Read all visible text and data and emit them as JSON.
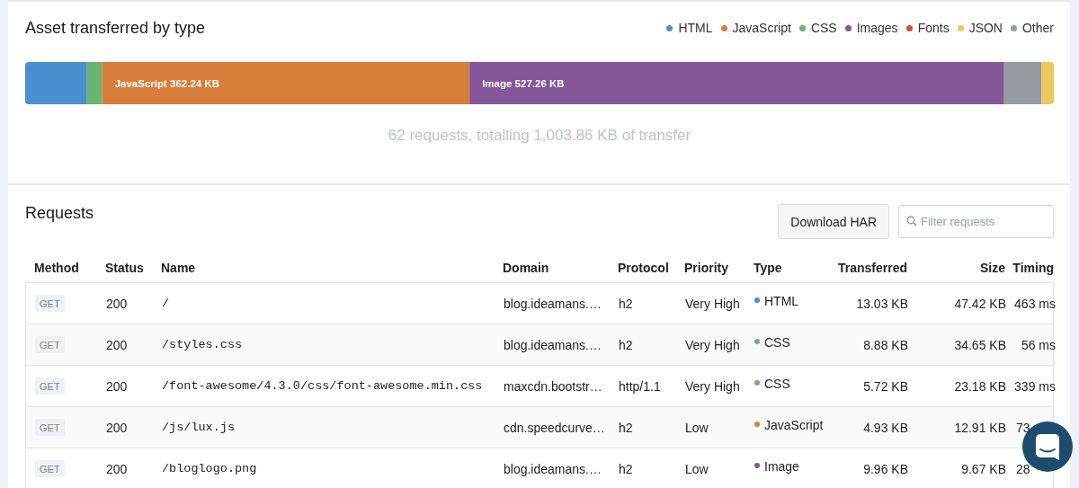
{
  "asset_panel": {
    "title": "Asset transferred by type",
    "legend": [
      {
        "label": "HTML",
        "color": "#4a90d0"
      },
      {
        "label": "JavaScript",
        "color": "#d77e3a"
      },
      {
        "label": "CSS",
        "color": "#67b56f"
      },
      {
        "label": "Images",
        "color": "#84569a"
      },
      {
        "label": "Fonts",
        "color": "#d64a3b"
      },
      {
        "label": "JSON",
        "color": "#ecc95a"
      },
      {
        "label": "Other",
        "color": "#959ba1"
      }
    ],
    "chart_data": {
      "type": "bar",
      "orientation": "horizontal",
      "stacked": true,
      "series": [
        {
          "color": "#4a90d0",
          "values": [
            61
          ]
        },
        {
          "color": "#67b56f",
          "values": [
            15
          ]
        },
        {
          "color": "#d77e3a",
          "values": [
            362.24
          ],
          "value_labels": [
            "JavaScript 362.24 KB"
          ]
        },
        {
          "color": "#84569a",
          "values": [
            527.26
          ],
          "value_labels": [
            "Image 527.26 KB"
          ]
        },
        {
          "color": "#959ba1",
          "values": [
            37
          ]
        },
        {
          "color": "#ecc95a",
          "values": [
            12
          ]
        }
      ]
    },
    "summary": "62 requests, totalling 1,003.86 KB of transfer"
  },
  "requests_panel": {
    "title": "Requests",
    "download_button": "Download HAR",
    "filter": {
      "placeholder": "Filter requests"
    },
    "columns": [
      "Method",
      "Status",
      "Name",
      "Domain",
      "Protocol",
      "Priority",
      "Type",
      "Transferred",
      "Size",
      "Timing"
    ],
    "rows": [
      {
        "method": "GET",
        "status": "200",
        "name": "/",
        "domain": "blog.ideamans.…",
        "protocol": "h2",
        "priority": "Very High",
        "type": {
          "label": "HTML",
          "color": "#4a90d0"
        },
        "transferred": "13.03 KB",
        "size": "47.42 KB",
        "timing": "463 ms"
      },
      {
        "method": "GET",
        "status": "200",
        "name": "/styles.css",
        "domain": "blog.ideamans.…",
        "protocol": "h2",
        "priority": "Very High",
        "type": {
          "label": "CSS",
          "color": "#67b56f"
        },
        "transferred": "8.88 KB",
        "size": "34.65 KB",
        "timing": "56 ms"
      },
      {
        "method": "GET",
        "status": "200",
        "name": "/font-awesome/4.3.0/css/font-awesome.min.css",
        "domain": "maxcdn.bootstr…",
        "protocol": "http/1.1",
        "priority": "Very High",
        "type": {
          "label": "CSS",
          "color": "#67b56f"
        },
        "transferred": "5.72 KB",
        "size": "23.18 KB",
        "timing": "339 ms"
      },
      {
        "method": "GET",
        "status": "200",
        "name": "/js/lux.js",
        "domain": "cdn.speedcurve…",
        "protocol": "h2",
        "priority": "Low",
        "type": {
          "label": "JavaScript",
          "color": "#d77e3a"
        },
        "transferred": "4.93 KB",
        "size": "12.91 KB",
        "timing": "73"
      },
      {
        "method": "GET",
        "status": "200",
        "name": "/bloglogo.png",
        "domain": "blog.ideamans.…",
        "protocol": "h2",
        "priority": "Low",
        "type": {
          "label": "Image",
          "color": "#84569a"
        },
        "transferred": "9.96 KB",
        "size": "9.67 KB",
        "timing": "28"
      }
    ]
  }
}
